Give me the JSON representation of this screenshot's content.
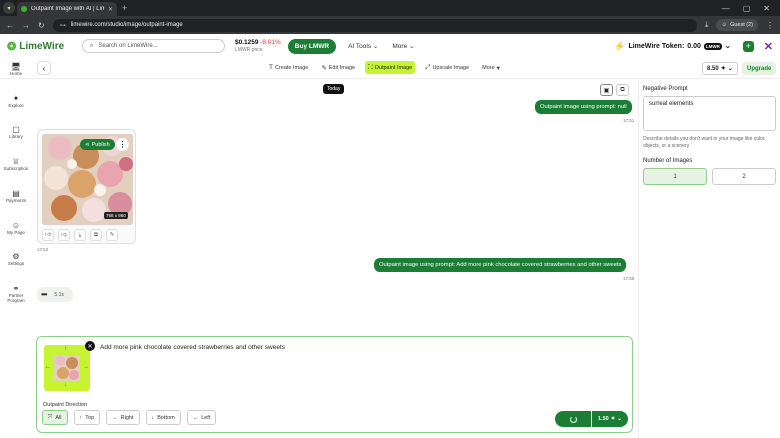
{
  "browser": {
    "tab_title": "Outpaint Image with AI | LimeW",
    "tab_close": "✕",
    "new_tab": "+",
    "url": "limewire.com/studio/image/outpaint-image",
    "profile_label": "Guest (2)"
  },
  "header": {
    "brand": "LimeWire",
    "search_placeholder": "Search on LimeWire...",
    "price": "$0.1259",
    "price_change": "-8.01%",
    "price_sub": "LMWR price",
    "buy_label": "Buy LMWR",
    "nav": [
      {
        "label": "AI Tools"
      },
      {
        "label": "More"
      }
    ],
    "token_label": "LimeWire Token:",
    "token_value": "0.00",
    "token_badge": "LMWR"
  },
  "toolbar": {
    "tools": [
      {
        "label": "Create Image",
        "icon": "T",
        "active": false
      },
      {
        "label": "Edit Image",
        "icon": "✎",
        "active": false
      },
      {
        "label": "Outpaint Image",
        "icon": "⛶",
        "active": true
      },
      {
        "label": "Upscale Image",
        "icon": "⤢",
        "active": false
      },
      {
        "label": "More",
        "icon": "▾",
        "active": false
      }
    ],
    "ratio": "8.50",
    "upgrade_label": "Upgrade"
  },
  "sidebar": {
    "items": [
      {
        "label": "Home",
        "icon": "🖥"
      },
      {
        "label": "Explore",
        "icon": "✦"
      },
      {
        "label": "Library",
        "icon": "▢"
      },
      {
        "label": "Subscription",
        "icon": "♕"
      },
      {
        "label": "Payments",
        "icon": "▤"
      },
      {
        "label": "My Page",
        "icon": "☺"
      },
      {
        "label": "Settings",
        "icon": "⚙"
      },
      {
        "label": "Partner Program",
        "icon": "⚭"
      }
    ]
  },
  "chat": {
    "today_label": "Today",
    "msg1": "Outpaint image using prompt: null",
    "msg1_time": "17:51",
    "image_card": {
      "publish_label": "Publish",
      "dimensions": "768 x 960",
      "time": "17:52"
    },
    "msg2": "Outpaint image using prompt: Add more pink chocolate covered strawberries and other sweets",
    "msg2_time": "17:55",
    "loading_time": "5.1s"
  },
  "prompt": {
    "text": "Add more pink chocolate covered strawberries and other sweets",
    "direction_label": "Outpaint Direction",
    "directions": [
      {
        "label": "All",
        "icon": "⤧",
        "active": true
      },
      {
        "label": "Top",
        "icon": "↑",
        "active": false
      },
      {
        "label": "Right",
        "icon": "→",
        "active": false
      },
      {
        "label": "Bottom",
        "icon": "↓",
        "active": false
      },
      {
        "label": "Left",
        "icon": "←",
        "active": false
      }
    ],
    "cost": "1.50"
  },
  "right_panel": {
    "negative_label": "Negative Prompt",
    "negative_value": "surreal elements",
    "negative_help": "Describe details you don't want in your image like color, objects, or a scenery.",
    "num_images_label": "Number of Images",
    "options": [
      "1",
      "2"
    ],
    "selected": "1"
  },
  "colors": {
    "brand_green": "#1b7e34",
    "lime_accent": "#c6f432",
    "negative_red": "#e53935"
  }
}
